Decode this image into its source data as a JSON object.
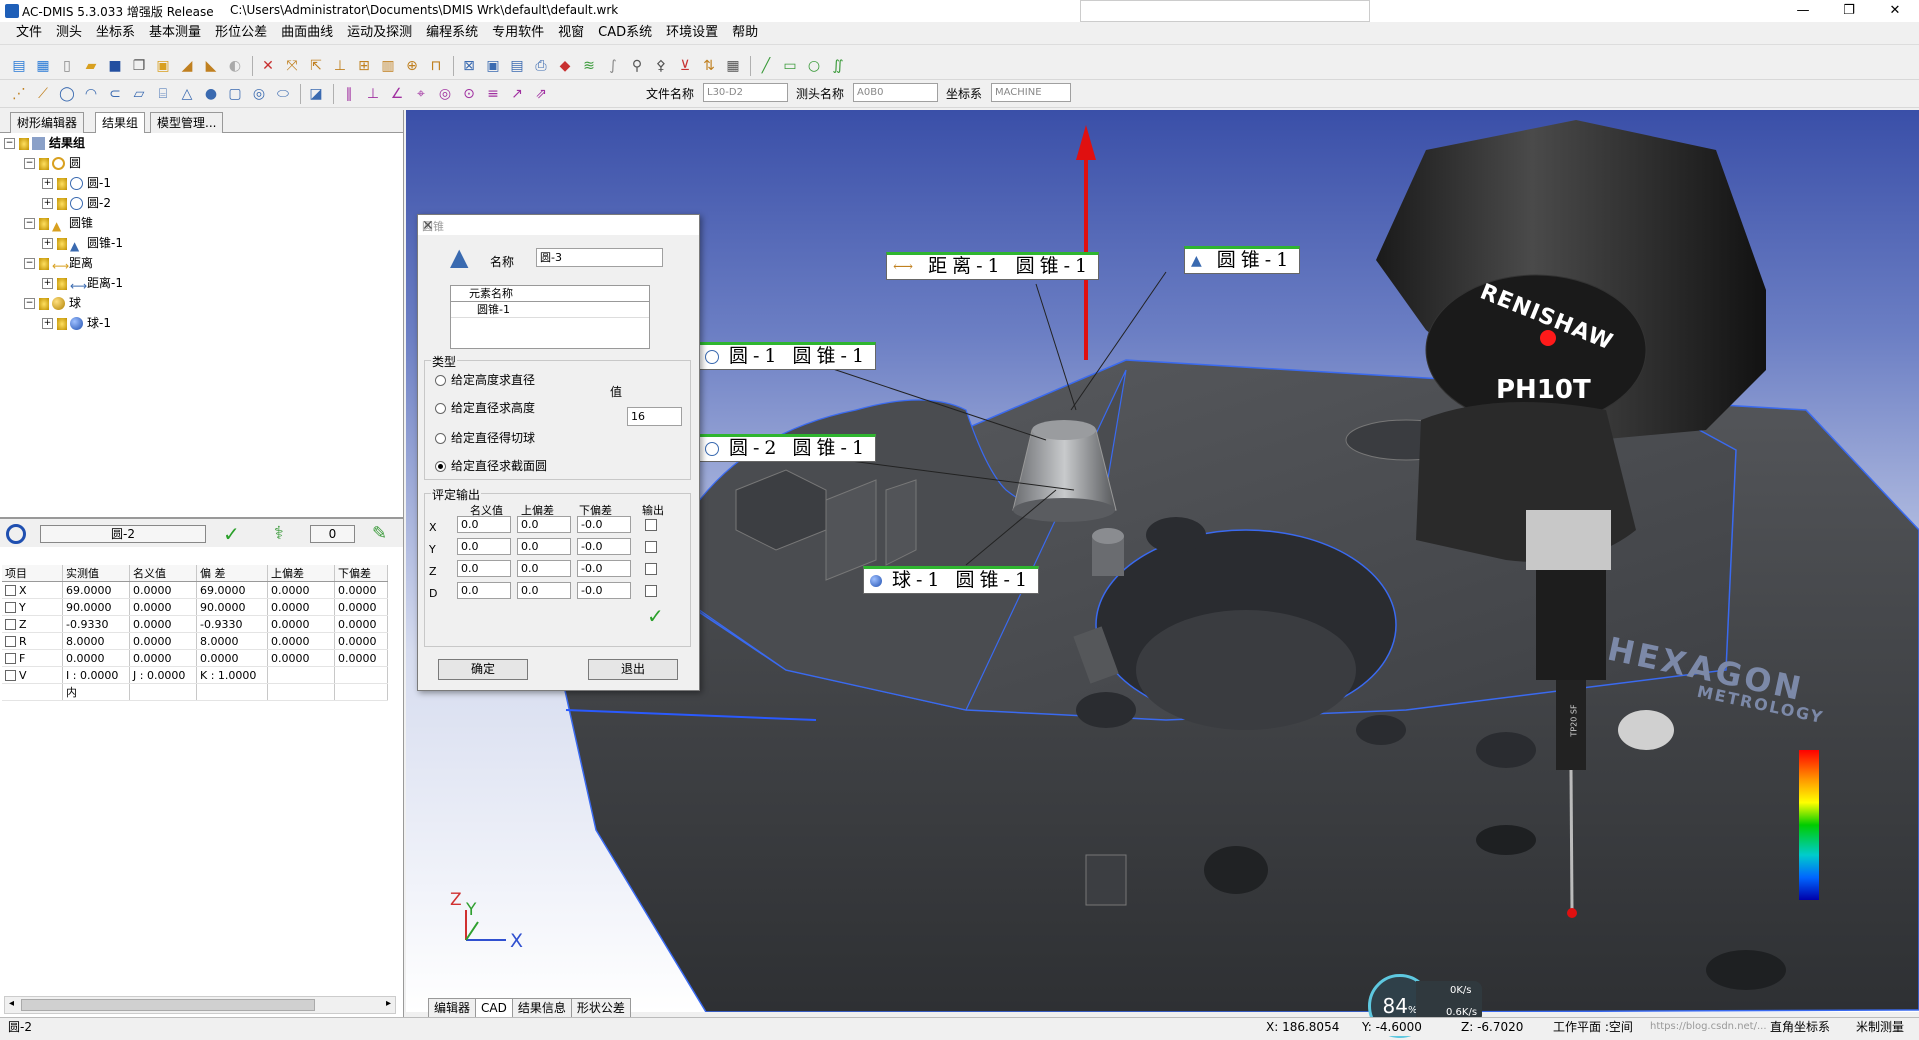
{
  "window": {
    "title": "AC-DMIS 5.3.033 增强版 Release",
    "path": "C:\\Users\\Administrator\\Documents\\DMIS Wrk\\default\\default.wrk",
    "min": "—",
    "max": "❐",
    "close": "✕"
  },
  "menu": [
    "文件",
    "测头",
    "坐标系",
    "基本测量",
    "形位公差",
    "曲面曲线",
    "运动及探测",
    "编程系统",
    "专用软件",
    "视窗",
    "CAD系统",
    "环境设置",
    "帮助"
  ],
  "toolbar2": {
    "file_label": "文件名称",
    "file_value": "L30-D2",
    "probe_label": "测头名称",
    "probe_value": "A0B0",
    "coord_label": "坐标系",
    "coord_value": "MACHINE"
  },
  "left_tabs": [
    "树形编辑器",
    "结果组",
    "模型管理..."
  ],
  "tree": {
    "root": "结果组",
    "groups": [
      {
        "label": "圆",
        "items": [
          "圆-1",
          "圆-2"
        ]
      },
      {
        "label": "圆锥",
        "items": [
          "圆锥-1"
        ]
      },
      {
        "label": "距离",
        "items": [
          "距离-1"
        ]
      },
      {
        "label": "球",
        "items": [
          "球-1"
        ]
      }
    ]
  },
  "result_panel": {
    "feature_name": "圆-2",
    "tolerance_value": "0",
    "columns": [
      "项目",
      "实测值",
      "名义值",
      "偏 差",
      "上偏差",
      "下偏差"
    ],
    "rows": [
      [
        "X",
        "69.0000",
        "0.0000",
        "69.0000",
        "0.0000",
        "0.0000"
      ],
      [
        "Y",
        "90.0000",
        "0.0000",
        "90.0000",
        "0.0000",
        "0.0000"
      ],
      [
        "Z",
        "-0.9330",
        "0.0000",
        "-0.9330",
        "0.0000",
        "0.0000"
      ],
      [
        "R",
        "8.0000",
        "0.0000",
        "8.0000",
        "0.0000",
        "0.0000"
      ],
      [
        "F",
        "0.0000",
        "0.0000",
        "0.0000",
        "0.0000",
        "0.0000"
      ]
    ],
    "v_row": {
      "label": "V",
      "i": "I : 0.0000",
      "j": "J : 0.0000",
      "k": "K : 1.0000"
    },
    "extra": "内"
  },
  "dialog": {
    "title": "圆锥",
    "name_label": "名称",
    "name_value": "圆-3",
    "element_header": "元素名称",
    "element_value": "圆锥-1",
    "type_group": "类型",
    "options": [
      "给定高度求直径",
      "给定直径求高度",
      "给定直径得切球",
      "给定直径求截面圆"
    ],
    "selected_option": 3,
    "value_label": "值",
    "value": "16",
    "output_group": "评定输出",
    "out_headers": [
      "名义值",
      "上偏差",
      "下偏差",
      "输出"
    ],
    "out_rows": [
      {
        "axis": "X",
        "nominal": "0.0",
        "upper": "0.0",
        "lower": "-0.0"
      },
      {
        "axis": "Y",
        "nominal": "0.0",
        "upper": "0.0",
        "lower": "-0.0"
      },
      {
        "axis": "Z",
        "nominal": "0.0",
        "upper": "0.0",
        "lower": "-0.0"
      },
      {
        "axis": "D",
        "nominal": "0.0",
        "upper": "0.0",
        "lower": "-0.0"
      }
    ],
    "ok": "确定",
    "exit": "退出"
  },
  "callouts": {
    "dist": "距离-1 圆锥-1",
    "cone": "圆锥-1",
    "circle1": "圆-1 圆锥-1",
    "circle2": "圆-2 圆锥-1",
    "sphere": "球-1 圆锥-1"
  },
  "viewport": {
    "probe_brand": "RENISHAW",
    "probe_model": "PH10T",
    "probe_stylus": "TP20 SF",
    "logo": "HEXAGON",
    "logo_sub": "METROLOGY",
    "axis_x": "X",
    "axis_y": "Y",
    "axis_z": "Z"
  },
  "bottom_tabs": [
    "编辑器",
    "CAD",
    "结果信息",
    "形状公差"
  ],
  "status": {
    "left": "圆-2",
    "x": "X: 186.8054",
    "y": "Y: -4.6000",
    "z": "Z: -6.7020",
    "plane": "工作平面 :空间",
    "coord": "直角坐标系",
    "unit": "米制测量",
    "url": "https://blog.csdn.net/...",
    "perf": "84",
    "perf_unit": "%",
    "up": "0K/s",
    "down": "0.6K/s"
  }
}
